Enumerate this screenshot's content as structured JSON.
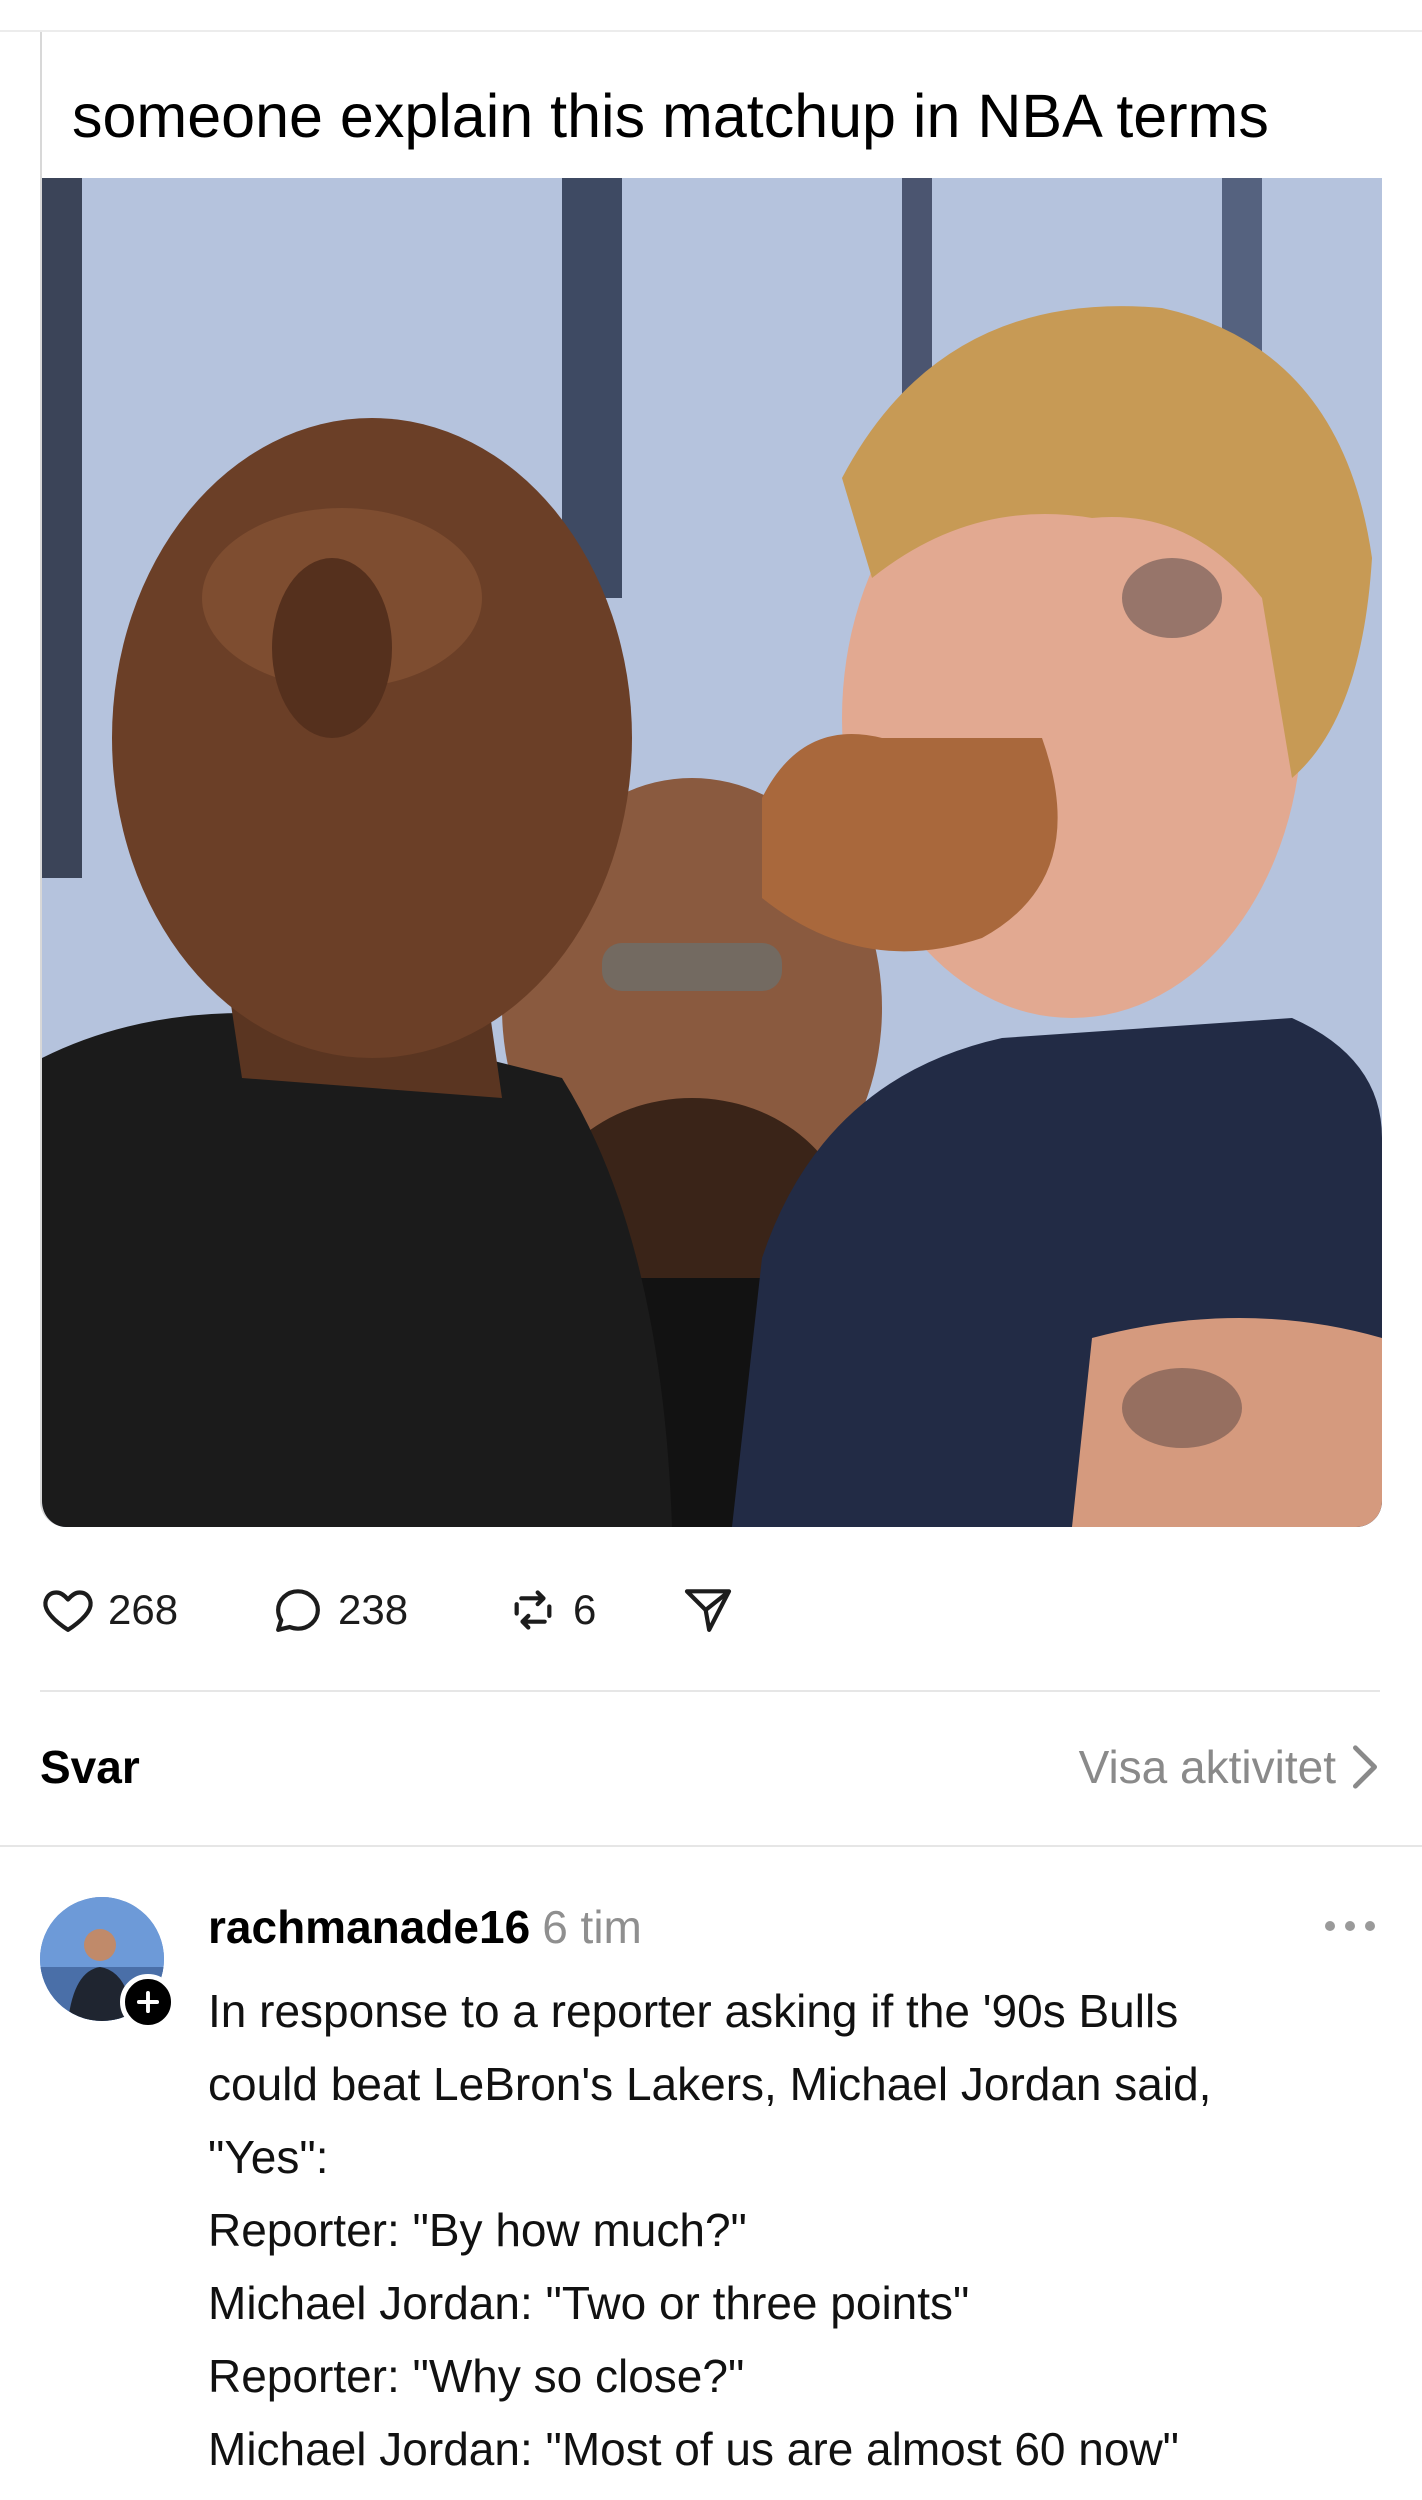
{
  "post": {
    "caption": "someone explain this matchup in NBA terms",
    "image_alt": "photo-two-boxers-face-off"
  },
  "actions": {
    "likes": "268",
    "comments": "238",
    "reposts": "6"
  },
  "replies": {
    "title": "Svar",
    "view_activity": "Visa aktivitet"
  },
  "reply": {
    "username": "rachmanade16",
    "time": "6 tim",
    "lines": [
      "In response to a reporter asking if the '90s Bulls",
      "could beat LeBron's Lakers, Michael Jordan said,",
      "\"Yes\":",
      "Reporter: \"By how much?\"",
      "Michael Jordan: \"Two or three points\"",
      "Reporter: \"Why so close?\"",
      "Michael Jordan: \"Most of us are almost 60 now\""
    ]
  },
  "colors": {
    "muted_text": "#8a8a8a",
    "divider": "#e6e6e6",
    "shirt_left": "#1b1b1b",
    "shirt_right": "#222b45"
  }
}
